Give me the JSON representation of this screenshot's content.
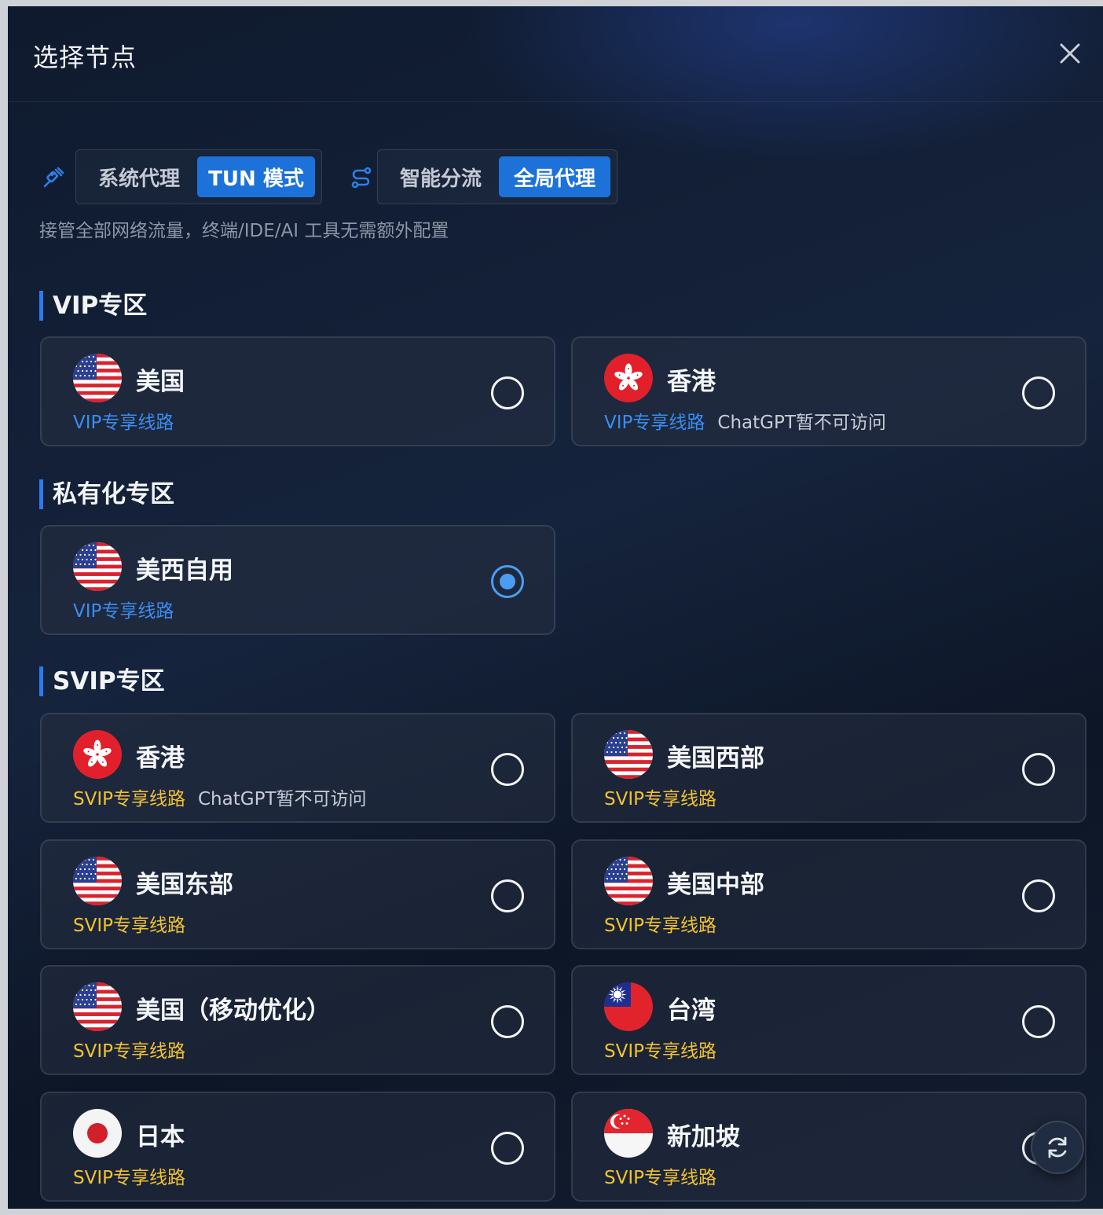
{
  "dialog": {
    "title": "选择节点"
  },
  "toolbar": {
    "proxy_modes": [
      {
        "label": "系统代理",
        "active": false
      },
      {
        "label": "TUN 模式",
        "active": true
      }
    ],
    "routing_modes": [
      {
        "label": "智能分流",
        "active": false
      },
      {
        "label": "全局代理",
        "active": true
      }
    ],
    "description": "接管全部网络流量，终端/IDE/AI 工具无需额外配置"
  },
  "sections": [
    {
      "title": "VIP专区",
      "nodes": [
        {
          "name": "美国",
          "flag": "us-flag-icon",
          "tier_label": "VIP专享线路",
          "tier": "vip",
          "note": "",
          "selected": false
        },
        {
          "name": "香港",
          "flag": "hk-flag-icon",
          "tier_label": "VIP专享线路",
          "tier": "vip",
          "note": "ChatGPT暂不可访问",
          "selected": false
        }
      ]
    },
    {
      "title": "私有化专区",
      "nodes": [
        {
          "name": "美西自用",
          "flag": "us-flag-icon",
          "tier_label": "VIP专享线路",
          "tier": "vip",
          "note": "",
          "selected": true
        }
      ]
    },
    {
      "title": "SVIP专区",
      "nodes": [
        {
          "name": "香港",
          "flag": "hk-flag-icon",
          "tier_label": "SVIP专享线路",
          "tier": "svip",
          "note": "ChatGPT暂不可访问",
          "selected": false
        },
        {
          "name": "美国西部",
          "flag": "us-flag-icon",
          "tier_label": "SVIP专享线路",
          "tier": "svip",
          "note": "",
          "selected": false
        },
        {
          "name": "美国东部",
          "flag": "us-flag-icon",
          "tier_label": "SVIP专享线路",
          "tier": "svip",
          "note": "",
          "selected": false
        },
        {
          "name": "美国中部",
          "flag": "us-flag-icon",
          "tier_label": "SVIP专享线路",
          "tier": "svip",
          "note": "",
          "selected": false
        },
        {
          "name": "美国（移动优化）",
          "flag": "us-flag-icon",
          "tier_label": "SVIP专享线路",
          "tier": "svip",
          "note": "",
          "selected": false
        },
        {
          "name": "台湾",
          "flag": "tw-flag-icon",
          "tier_label": "SVIP专享线路",
          "tier": "svip",
          "note": "",
          "selected": false
        },
        {
          "name": "日本",
          "flag": "jp-flag-icon",
          "tier_label": "SVIP专享线路",
          "tier": "svip",
          "note": "",
          "selected": false
        },
        {
          "name": "新加坡",
          "flag": "sg-flag-icon",
          "tier_label": "SVIP专享线路",
          "tier": "svip",
          "note": "",
          "selected": false
        }
      ]
    }
  ],
  "colors": {
    "accent": "#1c72d8",
    "vip_tag": "#3a8cf0",
    "svip_tag": "#f2c230",
    "radio_checked": "#4a9df2"
  },
  "icons": {
    "close": "close-icon",
    "proxy_mode": "plug-icon",
    "routing_mode": "route-icon",
    "refresh": "refresh-icon"
  }
}
